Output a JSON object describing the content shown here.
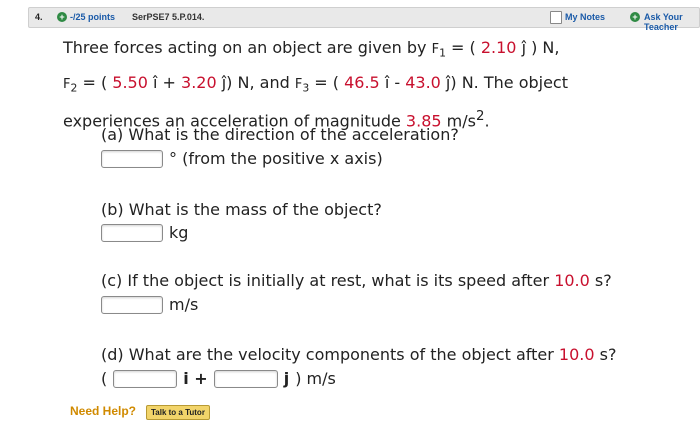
{
  "header": {
    "question_number": "4.",
    "points": "-/25 points",
    "problem_id": "SerPSE7 5.P.014.",
    "my_notes": "My Notes",
    "ask_teacher": "Ask Your Teacher"
  },
  "problem": {
    "intro_1": "Three forces acting on an object are given by ",
    "f1_label": "F",
    "f1_sub": "1",
    "eq_1": " = ( ",
    "f1_j": "2.10",
    "f1_j_unit": " ĵ ) N,",
    "f2_label": "F",
    "f2_sub": "2",
    "eq_2": " = ( ",
    "f2_i": "5.50",
    "f2_i_unit": " î + ",
    "f2_j": "3.20",
    "f2_j_unit": " ĵ) N, and ",
    "f3_label": "F",
    "f3_sub": "3",
    "eq_3": " = ( ",
    "f3_i": "46.5",
    "f3_i_unit": " î - ",
    "f3_j": "43.0",
    "f3_j_unit": " ĵ) N. The object",
    "intro_3": "experiences an acceleration of magnitude ",
    "accel": "3.85",
    "accel_unit": " m/s",
    "accel_exp": "2",
    "period": "."
  },
  "parts": {
    "a_question": "(a) What is the direction of the acceleration?",
    "a_unit": "° (from the positive x axis)",
    "b_question": "(b) What is the mass of the object?",
    "b_unit": "kg",
    "c_question_1": "(c) If the object is initially at rest, what is its speed after ",
    "c_time": "10.0",
    "c_question_2": " s?",
    "c_unit": "m/s",
    "d_question_1": "(d) What are the velocity components of the object after ",
    "d_time": "10.0",
    "d_question_2": " s?",
    "d_open": "(",
    "d_i": "i +",
    "d_j": "j",
    "d_unit": ") m/s"
  },
  "footer": {
    "need_help": "Need Help?",
    "tutor": "Talk to a Tutor"
  }
}
